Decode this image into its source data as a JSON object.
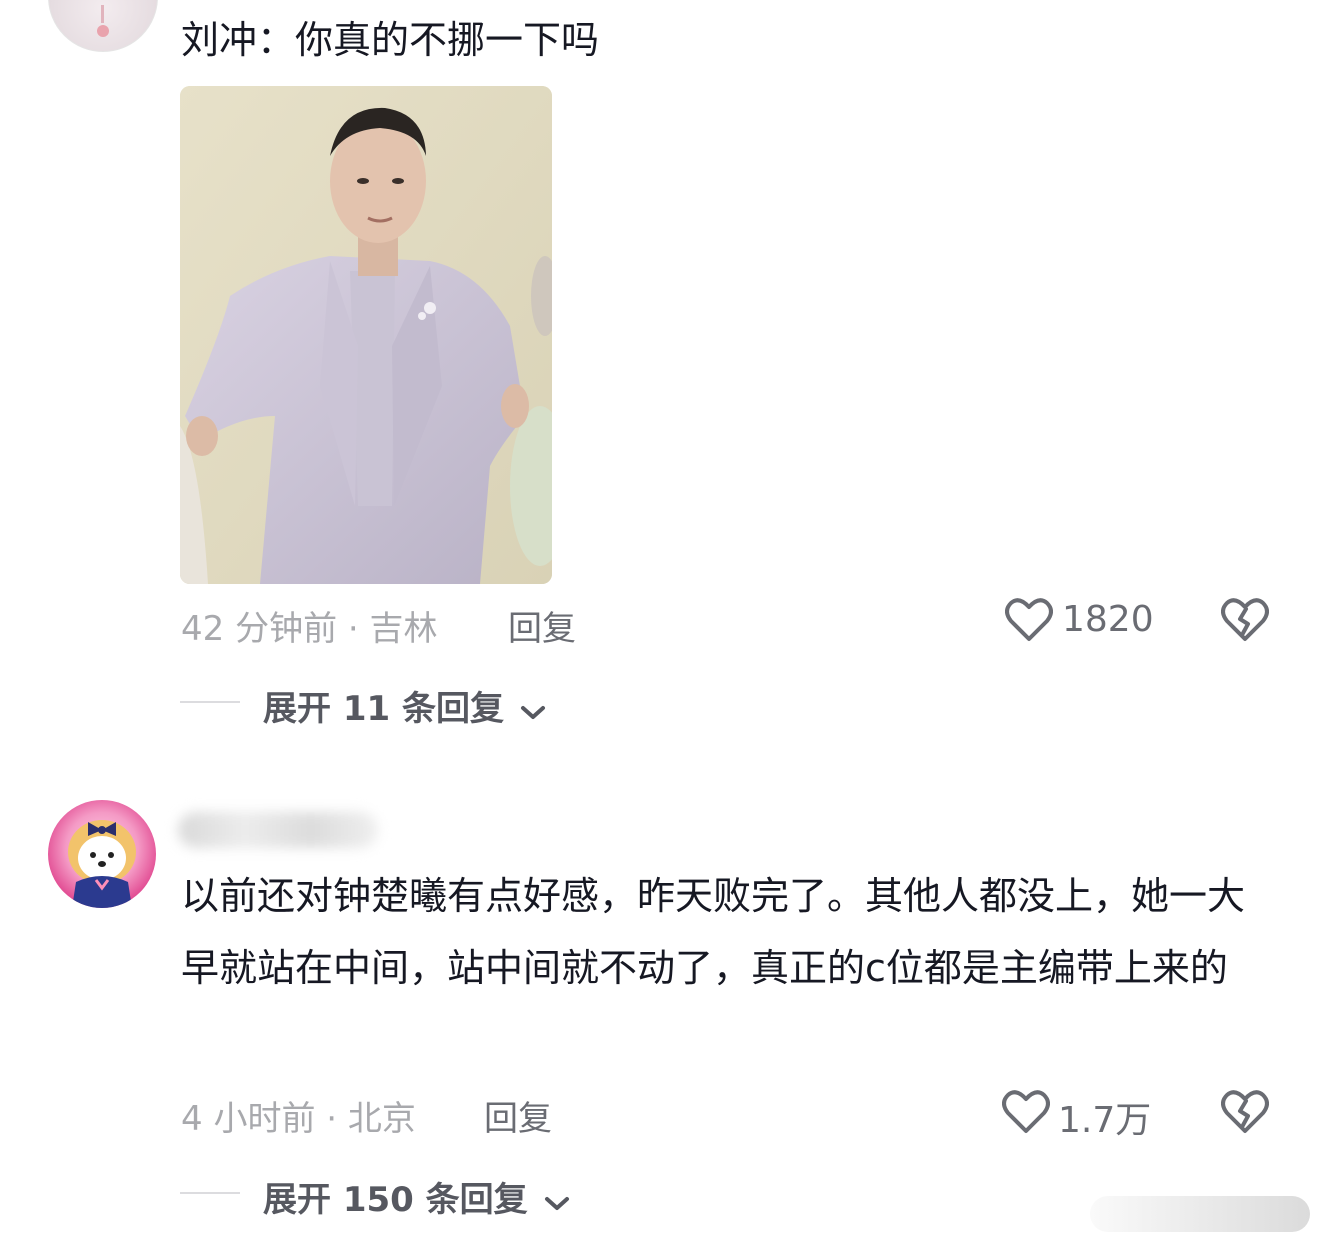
{
  "comments": [
    {
      "text": "刘冲：你真的不挪一下吗",
      "time": "42 分钟前 · 吉林",
      "reply_label": "回复",
      "likes": "1820",
      "expand_label": "展开 11 条回复"
    },
    {
      "text": "以前还对钟楚曦有点好感，昨天败完了。其他人都没上，她一大早就站在中间，站中间就不动了，真正的c位都是主编带上来的",
      "time": "4 小时前 · 北京",
      "reply_label": "回复",
      "likes": "1.7万",
      "expand_label": "展开 150 条回复"
    }
  ],
  "icons": {
    "like": "heart-outline-icon",
    "dislike": "broken-heart-icon",
    "expand": "chevron-down-icon"
  },
  "colors": {
    "text": "#161823",
    "meta": "#a8a9ad",
    "action": "#6a6c73"
  }
}
